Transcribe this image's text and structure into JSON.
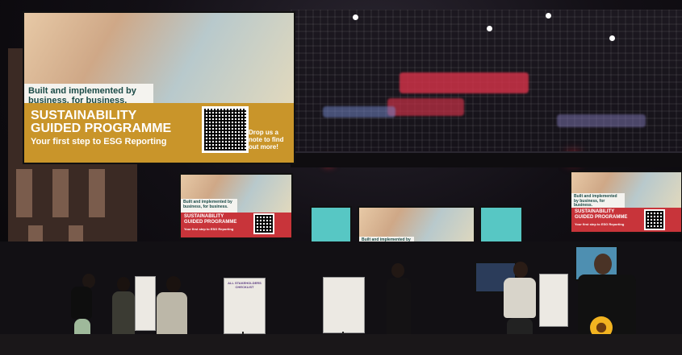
{
  "main_screen": {
    "headline": "Built and implemented by business, for business.",
    "title_line1": "SUSTAINABILITY",
    "title_line2": "GUIDED PROGRAMME",
    "subtitle": "Your first step to ESG Reporting",
    "qr_note": "Drop us a note to find out more!",
    "band_color": "#c9952a"
  },
  "side_screens": {
    "headline": "Built and implemented by business, for business.",
    "title_line1": "SUSTAINABILITY",
    "title_line2": "GUIDED PROGRAMME",
    "subtitle": "Your first step to ESG Reporting",
    "band_color": "#c8343a"
  },
  "center_screen": {
    "headline": "Built and implemented by business, for business."
  },
  "poster": {
    "title": "ALL STAKEHOLDERS CHECKLIST"
  },
  "colors": {
    "ceiling_accent": "#d8334a",
    "wall_panel": "#7a5c4c",
    "teal_screen": "#57c7c4"
  },
  "icons": {
    "qr": "qr-code-icon",
    "flower": "sunflower-icon"
  }
}
